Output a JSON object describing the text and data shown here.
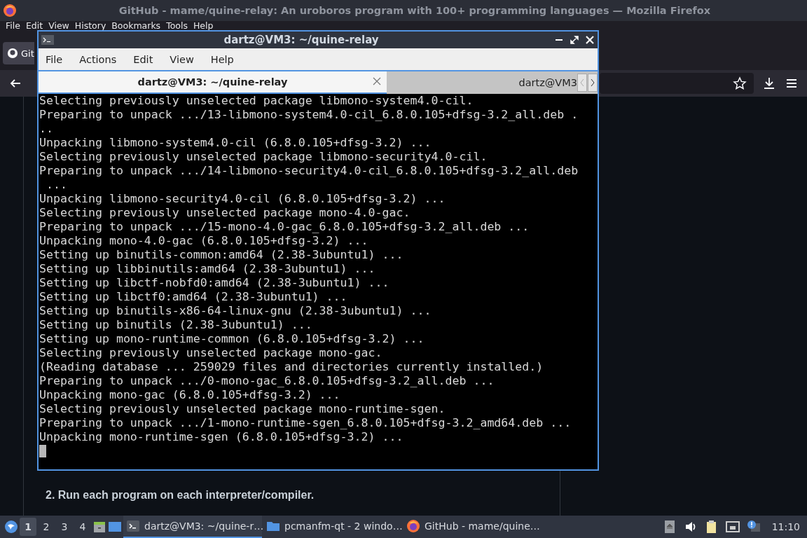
{
  "browser": {
    "title": "GitHub - mame/quine-relay: An uroboros program with 100+ programming languages — Mozilla Firefox",
    "menu": [
      "File",
      "Edit",
      "View",
      "History",
      "Bookmarks",
      "Tools",
      "Help"
    ],
    "tab": {
      "label": "Git"
    },
    "content": {
      "heading": "2. Run each program on each interpreter/compiler."
    }
  },
  "terminal": {
    "title": "dartz@VM3: ~/quine-relay",
    "menu": [
      "File",
      "Actions",
      "Edit",
      "View",
      "Help"
    ],
    "tabs": [
      {
        "label": "dartz@VM3: ~/quine-relay",
        "selected": true
      },
      {
        "label": "dartz@VM3",
        "selected": false
      }
    ],
    "lines": [
      "Selecting previously unselected package libmono-system4.0-cil.",
      "Preparing to unpack .../13-libmono-system4.0-cil_6.8.0.105+dfsg-3.2_all.deb .",
      "..",
      "Unpacking libmono-system4.0-cil (6.8.0.105+dfsg-3.2) ...",
      "Selecting previously unselected package libmono-security4.0-cil.",
      "Preparing to unpack .../14-libmono-security4.0-cil_6.8.0.105+dfsg-3.2_all.deb",
      " ...",
      "Unpacking libmono-security4.0-cil (6.8.0.105+dfsg-3.2) ...",
      "Selecting previously unselected package mono-4.0-gac.",
      "Preparing to unpack .../15-mono-4.0-gac_6.8.0.105+dfsg-3.2_all.deb ...",
      "Unpacking mono-4.0-gac (6.8.0.105+dfsg-3.2) ...",
      "Setting up binutils-common:amd64 (2.38-3ubuntu1) ...",
      "Setting up libbinutils:amd64 (2.38-3ubuntu1) ...",
      "Setting up libctf-nobfd0:amd64 (2.38-3ubuntu1) ...",
      "Setting up libctf0:amd64 (2.38-3ubuntu1) ...",
      "Setting up binutils-x86-64-linux-gnu (2.38-3ubuntu1) ...",
      "Setting up binutils (2.38-3ubuntu1) ...",
      "Setting up mono-runtime-common (6.8.0.105+dfsg-3.2) ...",
      "Selecting previously unselected package mono-gac.",
      "(Reading database ... 259029 files and directories currently installed.)",
      "Preparing to unpack .../0-mono-gac_6.8.0.105+dfsg-3.2_all.deb ...",
      "Unpacking mono-gac (6.8.0.105+dfsg-3.2) ...",
      "Selecting previously unselected package mono-runtime-sgen.",
      "Preparing to unpack .../1-mono-runtime-sgen_6.8.0.105+dfsg-3.2_amd64.deb ...",
      "Unpacking mono-runtime-sgen (6.8.0.105+dfsg-3.2) ..."
    ]
  },
  "taskbar": {
    "desktops": [
      {
        "label": "1",
        "selected": true
      },
      {
        "label": "2",
        "selected": false
      },
      {
        "label": "3",
        "selected": false
      },
      {
        "label": "4",
        "selected": false
      }
    ],
    "tasks": [
      {
        "kind": "terminal",
        "label": "dartz@VM3: ~/quine-r…",
        "selected": true
      },
      {
        "kind": "folder",
        "label": "pcmanfm-qt - 2 windo…",
        "selected": false
      },
      {
        "kind": "firefox",
        "label": "GitHub - mame/quine…",
        "selected": false
      }
    ],
    "clock": "11:10"
  }
}
